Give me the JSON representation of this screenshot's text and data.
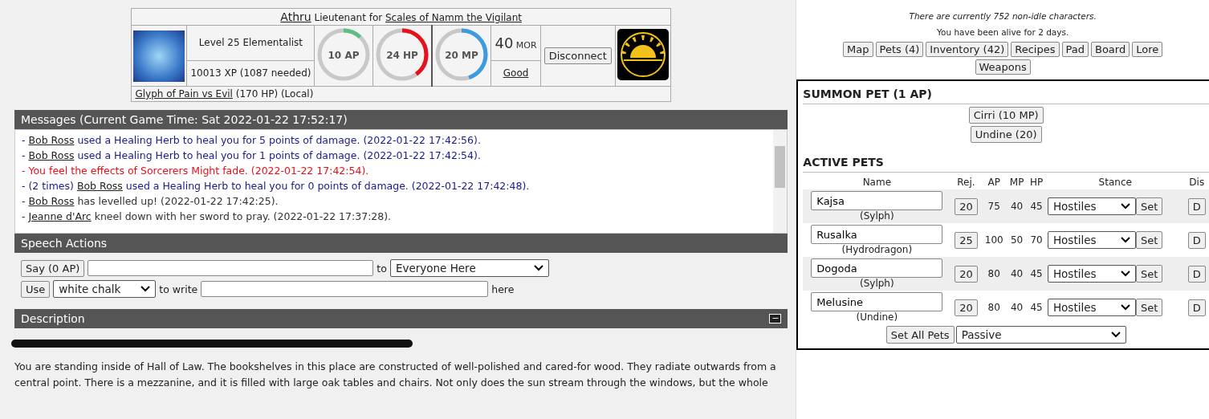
{
  "character": {
    "name": "Athru",
    "rank": "Lieutenant for",
    "faction": "Scales of Namm the Vigilant",
    "level": "Level 25 Elementalist",
    "xp": "10013 XP (1087 needed)",
    "gauges": [
      {
        "label": "10 AP",
        "level": 0.12,
        "color": "#5cbf7f"
      },
      {
        "label": "24 HP",
        "level": 0.4,
        "color": "#e8101a"
      },
      {
        "label": "20 MP",
        "level": 0.45,
        "color": "#3d9be0"
      }
    ],
    "morale": "40",
    "morale_unit": "MOR",
    "alignment": "Good",
    "disconnect": "Disconnect",
    "effect": "Glyph of Pain vs Evil",
    "effect_hp": "(170 HP) (Local)"
  },
  "messages": {
    "title": "Messages (Current Game Time: Sat 2022-01-22 17:52:17)",
    "items": [
      {
        "prefix": "- ",
        "actor": "Bob Ross",
        "text": " used a Healing Herb to heal you for 5 points of damage. (2022-01-22 17:42:56).",
        "color": "#1a1a8c"
      },
      {
        "prefix": "- ",
        "actor": "Bob Ross",
        "text": " used a Healing Herb to heal you for 1 points of damage. (2022-01-22 17:42:54).",
        "color": "#1a1a8c"
      },
      {
        "prefix": "- ",
        "text": "You feel the effects of Sorcerers Might fade. (2022-01-22 17:42:54).",
        "color": "#e8101a"
      },
      {
        "prefix": "- (2 times) ",
        "actor": "Bob Ross",
        "text": " used a Healing Herb to heal you for 0 points of damage. (2022-01-22 17:42:48).",
        "color": "#1a1a8c"
      },
      {
        "prefix": "- ",
        "actor": "Bob Ross",
        "text": " has levelled up! (2022-01-22 17:42:25).",
        "color": "#333333"
      },
      {
        "prefix": "- ",
        "actor": "Jeanne d'Arc",
        "text": " kneel down with her sword to pray. (2022-01-22 17:37:28).",
        "color": "#333333"
      }
    ]
  },
  "speech": {
    "title": "Speech Actions",
    "say_button": "Say (0 AP)",
    "to": "to",
    "target": "Everyone Here",
    "use_button": "Use",
    "tool": "white chalk",
    "to_write": "to write",
    "here": "here"
  },
  "description": {
    "title": "Description",
    "collapse": "−",
    "text": "You are standing inside of Hall of Law. The bookshelves in this place are constructed of well-polished and cared-for wood. They radiate outwards from a central point. There is a mezzanine, and it is filled with large oak tables and chairs. Not only does the sun stream through the windows, but the whole"
  },
  "status": {
    "characters": "There are currently 752 non-idle characters.",
    "alive": "You have been alive for 2 days."
  },
  "nav": [
    "Map",
    "Pets (4)",
    "Inventory (42)",
    "Recipes",
    "Pad",
    "Board",
    "Lore",
    "Weapons"
  ],
  "summon": {
    "title": "SUMMON PET (1 AP)",
    "buttons": [
      "Cirri (10 MP)",
      "Undine (20)"
    ]
  },
  "pets": {
    "title": "ACTIVE PETS",
    "columns": [
      "Name",
      "Rej.",
      "AP",
      "MP",
      "HP",
      "Stance",
      "Dis"
    ],
    "rows": [
      {
        "name": "Kajsa",
        "species": "(Sylph)",
        "rej": "20",
        "ap": "75",
        "mp": "40",
        "hp": "45",
        "stance": "Hostiles",
        "set": "Set",
        "dis": "D"
      },
      {
        "name": "Rusalka",
        "species": "(Hydrodragon)",
        "rej": "25",
        "ap": "100",
        "mp": "50",
        "hp": "70",
        "stance": "Hostiles",
        "set": "Set",
        "dis": "D"
      },
      {
        "name": "Dogoda",
        "species": "(Sylph)",
        "rej": "20",
        "ap": "80",
        "mp": "40",
        "hp": "45",
        "stance": "Hostiles",
        "set": "Set",
        "dis": "D"
      },
      {
        "name": "Melusine",
        "species": "(Undine)",
        "rej": "20",
        "ap": "80",
        "mp": "40",
        "hp": "45",
        "stance": "Hostiles",
        "set": "Set",
        "dis": "D"
      }
    ],
    "set_all": "Set All Pets",
    "set_all_stance": "Passive"
  }
}
